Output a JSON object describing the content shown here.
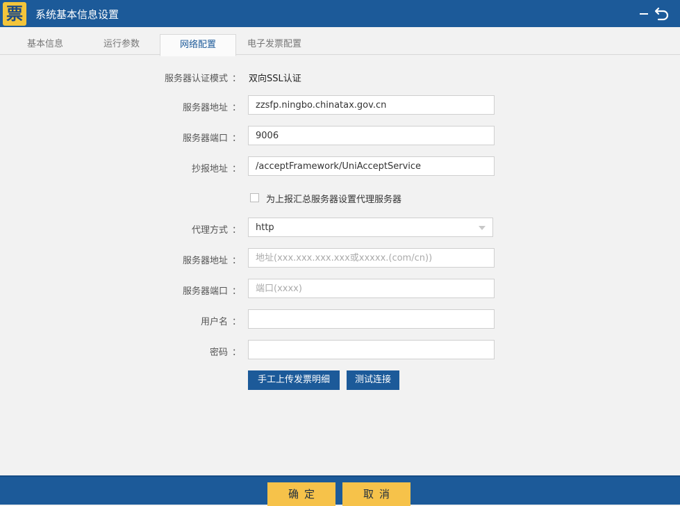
{
  "window": {
    "logo_char": "票",
    "title": "系统基本信息设置"
  },
  "tabs": [
    {
      "label": "基本信息",
      "active": false
    },
    {
      "label": "运行参数",
      "active": false
    },
    {
      "label": "网络配置",
      "active": true
    },
    {
      "label": "电子发票配置",
      "active": false
    }
  ],
  "form": {
    "auth_mode": {
      "label": "服务器认证模式",
      "value": "双向SSL认证"
    },
    "server_address": {
      "label": "服务器地址",
      "value": "zzsfp.ningbo.chinatax.gov.cn"
    },
    "server_port": {
      "label": "服务器端口",
      "value": "9006"
    },
    "report_address": {
      "label": "抄报地址",
      "value": "/acceptFramework/UniAcceptService"
    },
    "proxy_checkbox": {
      "label": "为上报汇总服务器设置代理服务器",
      "checked": false
    },
    "proxy_mode": {
      "label": "代理方式",
      "value": "http"
    },
    "proxy_server_address": {
      "label": "服务器地址",
      "value": "",
      "placeholder": "地址(xxx.xxx.xxx.xxx或xxxxx.(com/cn))"
    },
    "proxy_server_port": {
      "label": "服务器端口",
      "value": "",
      "placeholder": "端口(xxxx)"
    },
    "username": {
      "label": "用户名",
      "value": ""
    },
    "password": {
      "label": "密码",
      "value": ""
    },
    "colon": "："
  },
  "actions": {
    "manual_upload": "手工上传发票明细",
    "test_connection": "测试连接"
  },
  "footer": {
    "confirm": "确定",
    "cancel": "取消"
  },
  "colors": {
    "primary": "#1c5a99",
    "accent": "#f6c24a",
    "background": "#f2f2f2"
  }
}
